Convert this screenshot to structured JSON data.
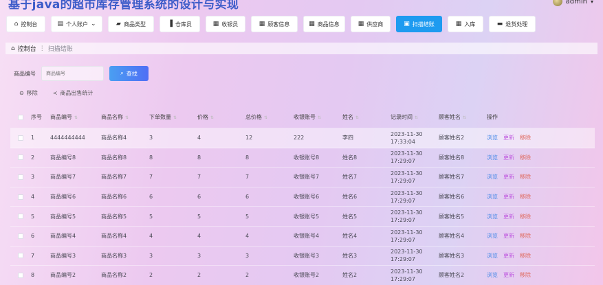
{
  "app": {
    "title": "基于java的超市库存管理系统的设计与实现",
    "user": "admin"
  },
  "nav": [
    {
      "label": "控制台",
      "icon": "home-icon"
    },
    {
      "label": "个人账户",
      "icon": "account-icon"
    },
    {
      "label": "商品类型",
      "icon": "category-icon"
    },
    {
      "label": "仓库员",
      "icon": "warehouse-icon"
    },
    {
      "label": "收银员",
      "icon": "grid-icon"
    },
    {
      "label": "顾客信息",
      "icon": "grid-icon"
    },
    {
      "label": "商品信息",
      "icon": "grid-icon"
    },
    {
      "label": "供应商",
      "icon": "grid-icon"
    },
    {
      "label": "扫描结账",
      "icon": "scan-icon"
    },
    {
      "label": "入库",
      "icon": "grid-icon"
    },
    {
      "label": "退货处理",
      "icon": "return-icon"
    }
  ],
  "breadcrumb": {
    "home": "控制台",
    "current": "扫描结账"
  },
  "search": {
    "label": "商品编号",
    "placeholder": "商品编号",
    "button": "查找"
  },
  "actions": {
    "remove": "移除",
    "stats": "商品出售统计"
  },
  "table": {
    "headers": {
      "no": "序号",
      "code": "商品编号",
      "name": "商品名称",
      "qty": "下单数量",
      "price": "价格",
      "total": "总价格",
      "acct": "收银账号",
      "uname": "姓名",
      "time": "记录时间",
      "cust": "顾客姓名",
      "ops": "操作"
    },
    "ops": {
      "view": "浏览",
      "update": "更新",
      "delete": "移除"
    },
    "rows": [
      {
        "no": "1",
        "code": "4444444444",
        "name": "商品名称4",
        "qty": "3",
        "price": "4",
        "total": "12",
        "acct": "222",
        "uname": "李四",
        "time": "2023-11-30 17:33:04",
        "cust": "顾客姓名2"
      },
      {
        "no": "2",
        "code": "商品编号8",
        "name": "商品名称8",
        "qty": "8",
        "price": "8",
        "total": "8",
        "acct": "收银账号8",
        "uname": "姓名8",
        "time": "2023-11-30 17:29:07",
        "cust": "顾客姓名8"
      },
      {
        "no": "3",
        "code": "商品编号7",
        "name": "商品名称7",
        "qty": "7",
        "price": "7",
        "total": "7",
        "acct": "收银账号7",
        "uname": "姓名7",
        "time": "2023-11-30 17:29:07",
        "cust": "顾客姓名7"
      },
      {
        "no": "4",
        "code": "商品编号6",
        "name": "商品名称6",
        "qty": "6",
        "price": "6",
        "total": "6",
        "acct": "收银账号6",
        "uname": "姓名6",
        "time": "2023-11-30 17:29:07",
        "cust": "顾客姓名6"
      },
      {
        "no": "5",
        "code": "商品编号5",
        "name": "商品名称5",
        "qty": "5",
        "price": "5",
        "total": "5",
        "acct": "收银账号5",
        "uname": "姓名5",
        "time": "2023-11-30 17:29:07",
        "cust": "顾客姓名5"
      },
      {
        "no": "6",
        "code": "商品编号4",
        "name": "商品名称4",
        "qty": "4",
        "price": "4",
        "total": "4",
        "acct": "收银账号4",
        "uname": "姓名4",
        "time": "2023-11-30 17:29:07",
        "cust": "顾客姓名4"
      },
      {
        "no": "7",
        "code": "商品编号3",
        "name": "商品名称3",
        "qty": "3",
        "price": "3",
        "total": "3",
        "acct": "收银账号3",
        "uname": "姓名3",
        "time": "2023-11-30 17:29:07",
        "cust": "顾客姓名3"
      },
      {
        "no": "8",
        "code": "商品编号2",
        "name": "商品名称2",
        "qty": "2",
        "price": "2",
        "total": "2",
        "acct": "收银账号2",
        "uname": "姓名2",
        "time": "2023-11-30 17:29:07",
        "cust": "顾客姓名2"
      }
    ]
  }
}
